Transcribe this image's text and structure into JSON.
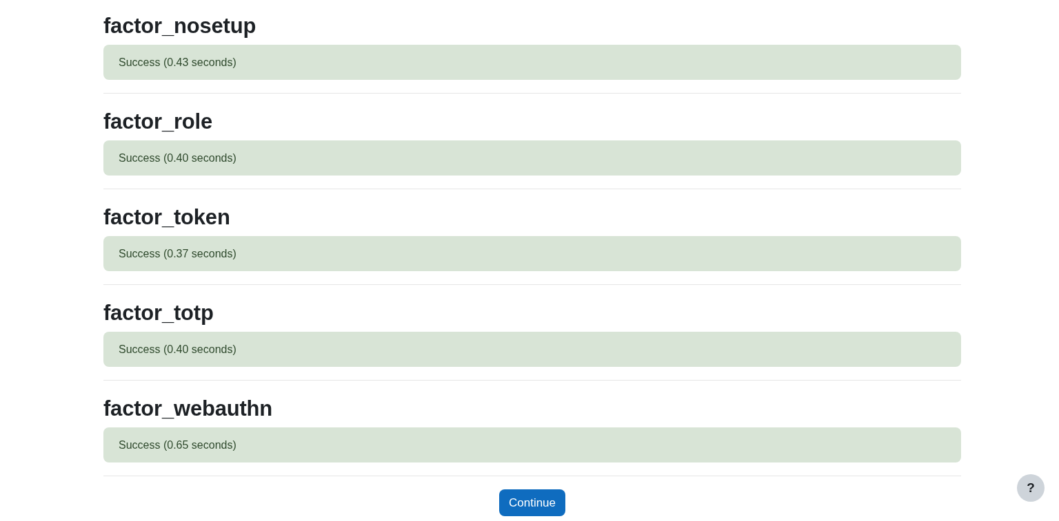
{
  "sections": [
    {
      "title": "factor_nosetup",
      "result": "Success (0.43 seconds)"
    },
    {
      "title": "factor_role",
      "result": "Success (0.40 seconds)"
    },
    {
      "title": "factor_token",
      "result": "Success (0.37 seconds)"
    },
    {
      "title": "factor_totp",
      "result": "Success (0.40 seconds)"
    },
    {
      "title": "factor_webauthn",
      "result": "Success (0.65 seconds)"
    }
  ],
  "continue_button": "Continue",
  "help_button": "?"
}
